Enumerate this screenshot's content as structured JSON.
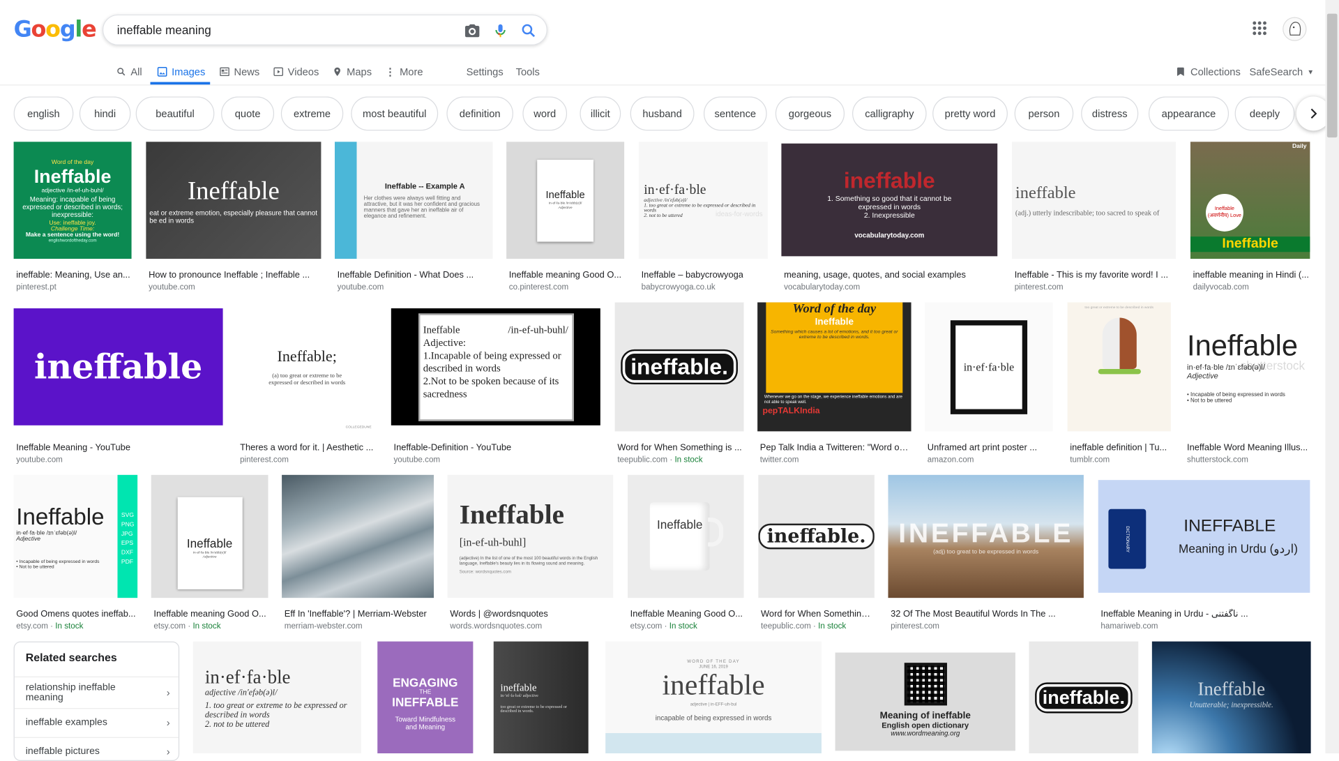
{
  "logo": {
    "letters": [
      "G",
      "o",
      "o",
      "g",
      "l",
      "e"
    ],
    "colors": [
      "#4285f4",
      "#ea4335",
      "#fbbc05",
      "#4285f4",
      "#34a853",
      "#ea4335"
    ]
  },
  "search": {
    "query": "ineffable meaning"
  },
  "tabs": [
    {
      "label": "All"
    },
    {
      "label": "Images"
    },
    {
      "label": "News"
    },
    {
      "label": "Videos"
    },
    {
      "label": "Maps"
    },
    {
      "label": "More"
    },
    {
      "label": "Settings"
    },
    {
      "label": "Tools"
    }
  ],
  "right_tools": {
    "collections": "Collections",
    "safesearch": "SafeSearch"
  },
  "chips": [
    "english",
    "hindi",
    "beautiful",
    "quote",
    "extreme",
    "most beautiful",
    "definition",
    "word",
    "illicit",
    "husband",
    "sentence",
    "gorgeous",
    "calligraphy",
    "pretty word",
    "person",
    "distress",
    "appearance",
    "deeply"
  ],
  "results": [
    {
      "caption": "ineffable: Meaning, Use an...",
      "source": "pinterest.pt",
      "stock": "",
      "thumb": {
        "title": "Ineffable",
        "top": "Word of the day",
        "sub": "adjective /in-ef-uh-buhl/",
        "body": "Meaning: incapable of being expressed or described in words; inexpressible:",
        "use": "Use: ineffable joy.",
        "challenge": "Challenge Time:",
        "footer": "Make a sentence using the word!",
        "site": "englishwordoftheday.com"
      }
    },
    {
      "caption": "How to pronounce Ineffable ; Ineffable ...",
      "source": "youtube.com",
      "stock": "",
      "thumb": {
        "title": "Ineffable",
        "body": "eat or extreme emotion, especially pleasure that cannot be ed in words"
      }
    },
    {
      "caption": "Ineffable Definition - What Does ...",
      "source": "youtube.com",
      "stock": "",
      "thumb": {
        "title": "Ineffable -- Example A",
        "body": "Her clothes were always well fitting and attractive, but it was her confident and gracious manners that gave her an ineffable air of elegance and refinement."
      }
    },
    {
      "caption": "Ineffable meaning Good O...",
      "source": "co.pinterest.com",
      "stock": "",
      "thumb": {
        "title": "Ineffable",
        "sub": "in·ef·fa·ble /in'ebb(e)l/",
        "body": "Adjective"
      }
    },
    {
      "caption": "Ineffable – babycrowyoga",
      "source": "babycrowyoga.co.uk",
      "stock": "",
      "thumb": {
        "title": "in·ef·fa·ble",
        "sub": "adjective  /in'efəb(ə)l/",
        "l1": "1. too great or extreme to be expressed or described in words",
        "l2": "2. not to be uttered",
        "wm": "ideas-for-words"
      }
    },
    {
      "caption": "meaning, usage, quotes, and social examples",
      "source": "vocabularytoday.com",
      "stock": "",
      "thumb": {
        "title": "ineffable",
        "body": "1. Something so good that it cannot be expressed in words",
        "body2": "2. Inexpressible",
        "site": "vocabularytoday.com"
      }
    },
    {
      "caption": "Ineffable - This is my favorite word! I ...",
      "source": "pinterest.com",
      "stock": "",
      "thumb": {
        "title": "ineffable",
        "body": "(adj.) utterly indescribable; too sacred to speak of"
      }
    },
    {
      "caption": "ineffable meaning in Hindi (...",
      "source": "dailyvocab.com",
      "stock": "",
      "thumb": {
        "title": "Ineffable",
        "top": "Daily",
        "badge": "Ineffable (अवर्णनीय) Love"
      }
    },
    {
      "caption": "Ineffable Meaning - YouTube",
      "source": "youtube.com",
      "stock": "",
      "thumb": {
        "title": "ineffable"
      }
    },
    {
      "caption": "Theres a word for it. | Aesthetic ...",
      "source": "pinterest.com",
      "stock": "",
      "thumb": {
        "title": "Ineffable;",
        "body": "(a) too great or extreme to be expressed or described in words",
        "site": "COLLEGEDUNE"
      }
    },
    {
      "caption": "Ineffable-Definition - YouTube",
      "source": "youtube.com",
      "stock": "",
      "thumb": {
        "title": "Ineffable",
        "sub": "/in-ef-uh-buhl/",
        "l1": "Adjective:",
        "l2": "1.Incapable of being expressed or described in words",
        "l3": "2.Not to be spoken because of its sacredness"
      }
    },
    {
      "caption": "Word for When Something is ...",
      "source": "teepublic.com",
      "stock": "In stock",
      "thumb": {
        "title": "ineffable."
      }
    },
    {
      "caption": "Pep Talk India a Twitteren: \"Word of ...",
      "source": "twitter.com",
      "stock": "",
      "thumb": {
        "title": "Word of the day",
        "sub": "Ineffable",
        "body": "Something which causes a lot of emotions, and it too great or extreme to be described in words.",
        "body2": "Whenever we go on the stage, we experience ineffable emotions and are not able to speak well.",
        "site": "pepTALKIndia"
      }
    },
    {
      "caption": "Unframed art print poster ...",
      "source": "amazon.com",
      "stock": "",
      "thumb": {
        "title": "in·ef·fa·ble"
      }
    },
    {
      "caption": "ineffable definition | Tu...",
      "source": "tumblr.com",
      "stock": "",
      "thumb": {
        "title": "ineffable",
        "body": "too great or extreme to be described in words"
      }
    },
    {
      "caption": "Ineffable Word Meaning Illus...",
      "source": "shutterstock.com",
      "stock": "",
      "thumb": {
        "title": "Ineffable",
        "sub": "in·ef·fa·ble  /ɪnˈɛfəb(ə)l/",
        "body": "Adjective",
        "l1": "• Incapable of being expressed in words",
        "l2": "• Not to be uttered",
        "wm": "shutterstock"
      }
    },
    {
      "caption": "Good Omens quotes ineffab...",
      "source": "etsy.com",
      "stock": "In stock",
      "thumb": {
        "title": "Ineffable",
        "sub": "in·ef·fa·ble  /ɪnˈɛfəb(ə)l/",
        "body": "Adjective",
        "l1": "• Incapable of being expressed in words",
        "l2": "• Not to be uttered",
        "formats": "SVG PNG JPG EPS DXF PDF"
      }
    },
    {
      "caption": "Ineffable meaning Good O...",
      "source": "etsy.com",
      "stock": "In stock",
      "thumb": {
        "title": "Ineffable",
        "sub": "in·ef·fa·ble /in'ebb(e)l/",
        "body": "Adjective"
      }
    },
    {
      "caption": "Eff In 'Ineffable'? | Merriam-Webster",
      "source": "merriam-webster.com",
      "stock": "",
      "thumb": {}
    },
    {
      "caption": "Words | @wordsnquotes",
      "source": "words.wordsnquotes.com",
      "stock": "",
      "thumb": {
        "title": "Ineffable",
        "sub": "[in-ef-uh-buhl]",
        "body": "(adjective) In the list of one of the most 100 beautiful words in the English language, Ineffable's beauty lies in its flowing sound and meaning.",
        "site": "Source: wordsnquotes.com"
      }
    },
    {
      "caption": "Ineffable Meaning Good O...",
      "source": "etsy.com",
      "stock": "In stock",
      "thumb": {
        "title": "Ineffable"
      }
    },
    {
      "caption": "Word for When Something...",
      "source": "teepublic.com",
      "stock": "In stock",
      "thumb": {
        "title": "ineffable."
      }
    },
    {
      "caption": "32 Of The Most Beautiful Words In The ...",
      "source": "pinterest.com",
      "stock": "",
      "thumb": {
        "title": "INEFFABLE",
        "body": "(adj) too great to be expressed in words"
      }
    },
    {
      "caption": "Ineffable Meaning in Urdu - ناگفتنی ...",
      "source": "hamariweb.com",
      "stock": "",
      "thumb": {
        "title": "INEFFABLE",
        "sub": "Meaning in Urdu (اردو)",
        "book": "DICTIONARY"
      }
    },
    {
      "caption": "",
      "source": "",
      "stock": "",
      "thumb": {
        "title": "in·ef·fa·ble",
        "sub": "adjective  /in'efəb(ə)l/",
        "l1": "1. too great or extreme to be expressed or described in words",
        "l2": "2. not to be uttered"
      }
    },
    {
      "caption": "",
      "source": "",
      "stock": "",
      "thumb": {
        "top": "ENGAGING",
        "sub": "THE",
        "title": "INEFFABLE",
        "body": "Toward Mindfulness and Meaning"
      }
    },
    {
      "caption": "",
      "source": "",
      "stock": "",
      "thumb": {
        "title": "ineffable",
        "sub": "in·'ef·fa·bəl/ adjective",
        "body": "too great or extreme to be expressed or described in words."
      }
    },
    {
      "caption": "",
      "source": "",
      "stock": "",
      "thumb": {
        "top": "WORD OF THE DAY",
        "sub": "JUNE 16, 2019",
        "title": "ineffable",
        "l1": "adjective | in-EFF-uh-bul",
        "body": "incapable of being expressed in words"
      }
    },
    {
      "caption": "",
      "source": "",
      "stock": "",
      "thumb": {
        "title": "Meaning of ineffable",
        "sub": "English open dictionary",
        "site": "www.wordmeaning.org"
      }
    },
    {
      "caption": "",
      "source": "",
      "stock": "",
      "thumb": {
        "title": "ineffable."
      }
    },
    {
      "caption": "",
      "source": "",
      "stock": "",
      "thumb": {
        "title": "Ineffable",
        "body": "Unutterable; inexpressible."
      }
    }
  ],
  "related": {
    "title": "Related searches",
    "items": [
      "relationship ineffable meaning",
      "ineffable examples",
      "ineffable pictures"
    ]
  }
}
